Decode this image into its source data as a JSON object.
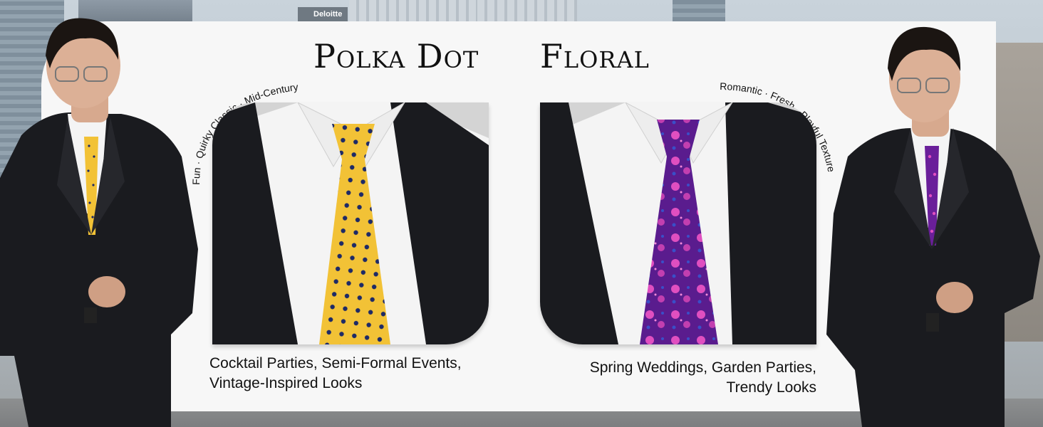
{
  "background": {
    "sign_text": "Deloitte"
  },
  "polka": {
    "title": "Polka Dot",
    "tagline": "Fun · Quirky Classic · Mid-Century",
    "caption_line1": "Cocktail Parties, Semi-Formal Events,",
    "caption_line2": "Vintage-Inspired Looks",
    "tie_color": "#f2c236",
    "dot_color": "#1e2a66"
  },
  "floral": {
    "title": "Floral",
    "tagline": "Romantic · Fresh · Playful Texture",
    "caption_line1": "Spring Weddings, Garden Parties,",
    "caption_line2": "Trendy Looks",
    "tie_color": "#6a1f9a",
    "flower_color": "#e04fc0"
  },
  "colors": {
    "suit": "#1a1b1f",
    "shirt": "#f4f4f4",
    "panel": "#f7f7f7"
  }
}
